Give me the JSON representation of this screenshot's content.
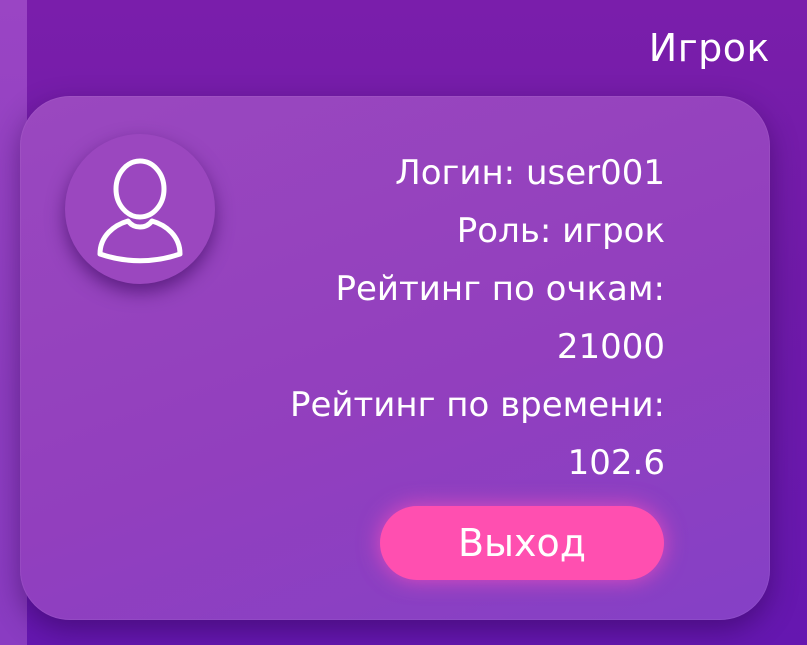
{
  "header": {
    "title": "Игрок"
  },
  "profile": {
    "avatar_icon": "user-icon",
    "login": "Логин: user001",
    "role": "Роль: игрок",
    "score_rating_label": "Рейтинг по очкам:",
    "score_rating_value": "21000",
    "time_rating_label": "Рейтинг по времени:",
    "time_rating_value": "102.6",
    "logout_label": "Выход"
  },
  "colors": {
    "background": "#7a1eab",
    "card": "#923fbe",
    "accent_button": "#ff4fb0",
    "text": "#ffffff"
  }
}
